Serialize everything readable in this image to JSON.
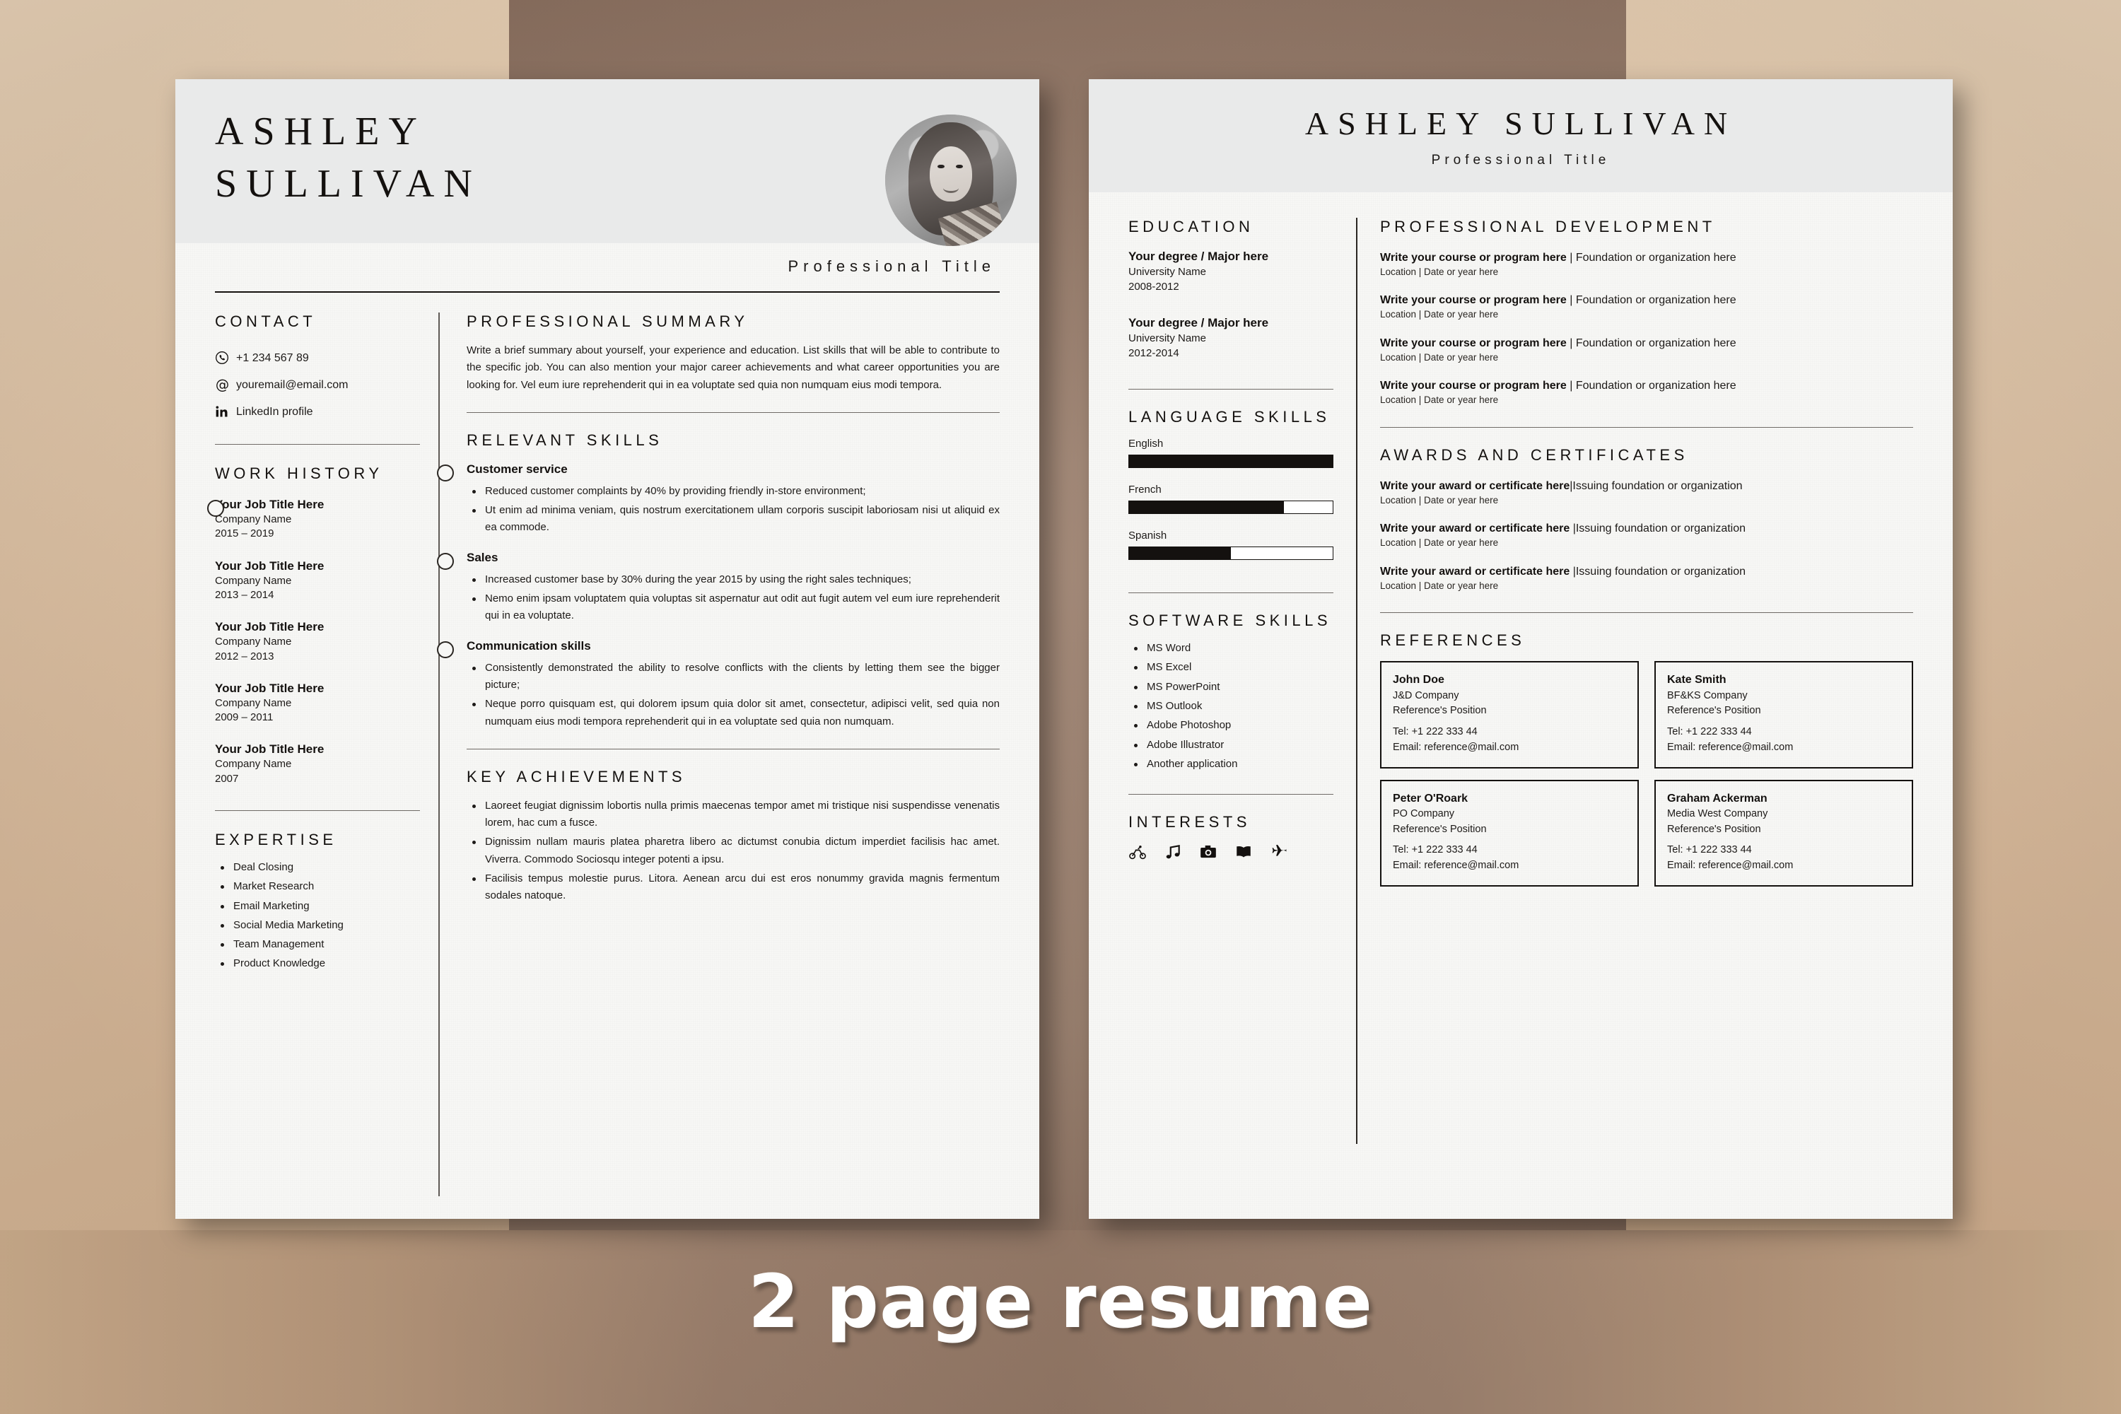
{
  "caption": "2 page resume",
  "person": {
    "first_name": "ASHLEY",
    "last_name": "SULLIVAN",
    "full_name": "ASHLEY  SULLIVAN",
    "title": "Professional Title"
  },
  "page1": {
    "contact": {
      "heading": "CONTACT",
      "items": [
        {
          "icon": "phone-icon",
          "value": "+1 234 567 89"
        },
        {
          "icon": "at-email-icon",
          "value": "youremail@email.com"
        },
        {
          "icon": "linkedin-icon",
          "value": "LinkedIn profile"
        }
      ]
    },
    "work_history": {
      "heading": "WORK HISTORY",
      "jobs": [
        {
          "title": "Your Job Title Here",
          "company": "Company Name",
          "dates": "2015 – 2019"
        },
        {
          "title": "Your Job Title Here",
          "company": "Company Name",
          "dates": "2013 – 2014"
        },
        {
          "title": "Your Job Title Here",
          "company": "Company Name",
          "dates": "2012 – 2013"
        },
        {
          "title": "Your Job Title Here",
          "company": "Company Name",
          "dates": "2009 – 2011"
        },
        {
          "title": "Your Job Title Here",
          "company": "Company Name",
          "dates": "2007"
        }
      ]
    },
    "expertise": {
      "heading": "EXPERTISE",
      "items": [
        "Deal Closing",
        "Market Research",
        "Email Marketing",
        "Social Media Marketing",
        "Team Management",
        "Product Knowledge"
      ]
    },
    "summary": {
      "heading": "PROFESSIONAL SUMMARY",
      "text": "Write a brief summary about yourself, your experience and education. List skills that will be able to contribute to the specific job. You can also mention your major career achievements and what career opportunities you are looking for. Vel eum iure reprehenderit qui in ea voluptate sed quia non numquam eius modi tempora."
    },
    "relevant_skills": {
      "heading": "RELEVANT SKILLS",
      "groups": [
        {
          "name": "Customer service",
          "bullets": [
            "Reduced customer complaints by 40% by providing friendly in-store environment;",
            "Ut enim ad minima veniam, quis nostrum exercitationem ullam corporis suscipit laboriosam nisi ut aliquid ex ea commode."
          ]
        },
        {
          "name": "Sales",
          "bullets": [
            "Increased customer base by 30% during the year 2015 by using the right sales techniques;",
            "Nemo enim ipsam voluptatem quia voluptas sit aspernatur aut odit aut fugit autem vel eum iure reprehenderit qui in ea voluptate."
          ]
        },
        {
          "name": "Communication skills",
          "bullets": [
            "Consistently demonstrated the ability to resolve conflicts with the clients by letting them see the bigger picture;",
            "Neque porro quisquam est, qui dolorem ipsum quia dolor sit amet, consectetur, adipisci velit, sed quia non numquam eius modi tempora reprehenderit qui in ea voluptate sed quia non numquam."
          ]
        }
      ]
    },
    "key_achievements": {
      "heading": "KEY ACHIEVEMENTS",
      "bullets": [
        "Laoreet feugiat dignissim lobortis nulla primis maecenas tempor amet mi tristique nisi suspendisse venenatis lorem, hac cum a fusce.",
        "Dignissim nullam mauris platea pharetra libero ac dictumst conubia dictum imperdiet facilisis hac amet. Viverra. Commodo Sociosqu integer potenti a ipsu.",
        "Facilisis tempus molestie purus. Litora. Aenean arcu dui est eros nonummy gravida magnis fermentum sodales natoque."
      ]
    }
  },
  "page2": {
    "education": {
      "heading": "EDUCATION",
      "entries": [
        {
          "degree": "Your degree / Major here",
          "university": "University Name",
          "years": "2008-2012"
        },
        {
          "degree": "Your degree / Major here",
          "university": "University Name",
          "years": "2012-2014"
        }
      ]
    },
    "language_skills": {
      "heading": "LANGUAGE SKILLS",
      "items": [
        {
          "name": "English",
          "level": 100
        },
        {
          "name": "French",
          "level": 76
        },
        {
          "name": "Spanish",
          "level": 50
        }
      ]
    },
    "software_skills": {
      "heading": "SOFTWARE SKILLS",
      "items": [
        "MS Word",
        "MS Excel",
        "MS PowerPoint",
        "MS Outlook",
        "Adobe Photoshop",
        "Adobe Illustrator",
        "Another application"
      ]
    },
    "interests": {
      "heading": "INTERESTS",
      "icons": [
        "bicycle-icon",
        "music-note-icon",
        "camera-icon",
        "book-icon",
        "airplane-icon"
      ]
    },
    "professional_development": {
      "heading": "PROFESSIONAL DEVELOPMENT",
      "entries": [
        {
          "course": "Write your course or program here",
          "sep": " | ",
          "org": "Foundation or organization here",
          "meta": "Location | Date or year here"
        },
        {
          "course": "Write your course or program here",
          "sep": " | ",
          "org": "Foundation or organization here",
          "meta": "Location | Date or year here"
        },
        {
          "course": "Write your course or program here",
          "sep": " | ",
          "org": "Foundation or organization here",
          "meta": "Location | Date or year here"
        },
        {
          "course": "Write your course or program here",
          "sep": " | ",
          "org": "Foundation or organization here",
          "meta": "Location | Date or year here"
        }
      ]
    },
    "awards": {
      "heading": "AWARDS AND CERTIFICATES",
      "entries": [
        {
          "award": "Write your award or certificate here",
          "sep": "|",
          "org": "Issuing foundation or organization",
          "meta": "Location | Date or year here"
        },
        {
          "award": "Write your award or certificate here",
          "sep": " |",
          "org": "Issuing foundation or organization",
          "meta": "Location | Date or year here"
        },
        {
          "award": "Write your award or certificate here",
          "sep": " |",
          "org": "Issuing foundation or organization",
          "meta": "Location | Date or year here"
        }
      ]
    },
    "references": {
      "heading": "REFERENCES",
      "items": [
        {
          "name": "John Doe",
          "company": "J&D Company",
          "position": "Reference's Position",
          "tel": "Tel: +1 222 333 44",
          "email": "Email: reference@mail.com"
        },
        {
          "name": "Kate Smith",
          "company": "BF&KS Company",
          "position": "Reference's Position",
          "tel": "Tel: +1 222 333 44",
          "email": "Email: reference@mail.com"
        },
        {
          "name": "Peter O'Roark",
          "company": "PO Company",
          "position": "Reference's Position",
          "tel": "Tel: +1 222 333 44",
          "email": "Email: reference@mail.com"
        },
        {
          "name": "Graham Ackerman",
          "company": "Media West Company",
          "position": "Reference's Position",
          "tel": "Tel: +1 222 333 44",
          "email": "Email: reference@mail.com"
        }
      ]
    }
  },
  "colors": {
    "paper": "#f7f7f5",
    "header_band": "#e9eaea",
    "ink": "#14110f",
    "accent_bar": "#14110f"
  }
}
